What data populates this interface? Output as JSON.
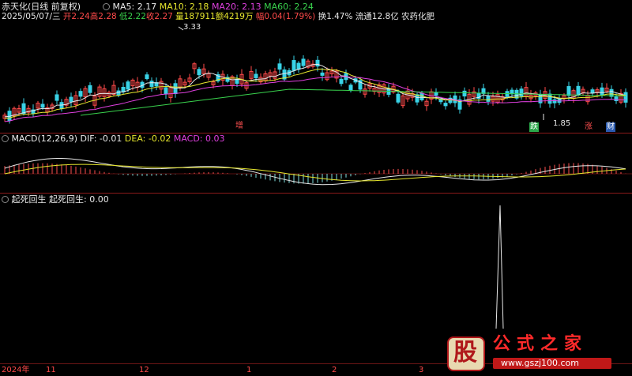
{
  "header": {
    "stock_name": "赤天化(日线 前复权)",
    "ma5": "MA5: 2.17",
    "ma10": "MA10: 2.18",
    "ma20": "MA20: 2.13",
    "ma60": "MA60: 2.24"
  },
  "quote": {
    "date": "2025/05/07/三",
    "open": "开2.24",
    "high": "高2.28",
    "low": "低2.22",
    "close": "收2.27",
    "volume": "量187911",
    "amount": "额4219万",
    "change": "幅0.04(1.79%)",
    "turnover": "换1.47%",
    "float": "流通12.8亿",
    "sector": "农药化肥"
  },
  "price_panel": {
    "peak_label": "3.33",
    "low_label": "1.85",
    "tag_increase": "增",
    "tag_fall": "跌",
    "tag_rise": "涨",
    "tag_finance": "财"
  },
  "macd_panel": {
    "title": "MACD(12,26,9)",
    "dif": "DIF: -0.01",
    "dea": "DEA: -0.02",
    "macd": "MACD: 0.03"
  },
  "indicator_panel": {
    "title": "起死回生",
    "label": "起死回生: 0.00"
  },
  "time_axis": [
    "2024年",
    "11",
    "12",
    "1",
    "2",
    "3"
  ],
  "watermark": {
    "text": "公式之家",
    "url": "www.gszj100.com",
    "logo_char": "股"
  },
  "colors": {
    "up": "#ff4a4a",
    "down": "#39d2e6",
    "ma5": "#e8e8e8",
    "ma10": "#e6e62d",
    "ma20": "#e040e0",
    "ma60": "#39d24d",
    "separator": "#8a1a1a"
  }
}
